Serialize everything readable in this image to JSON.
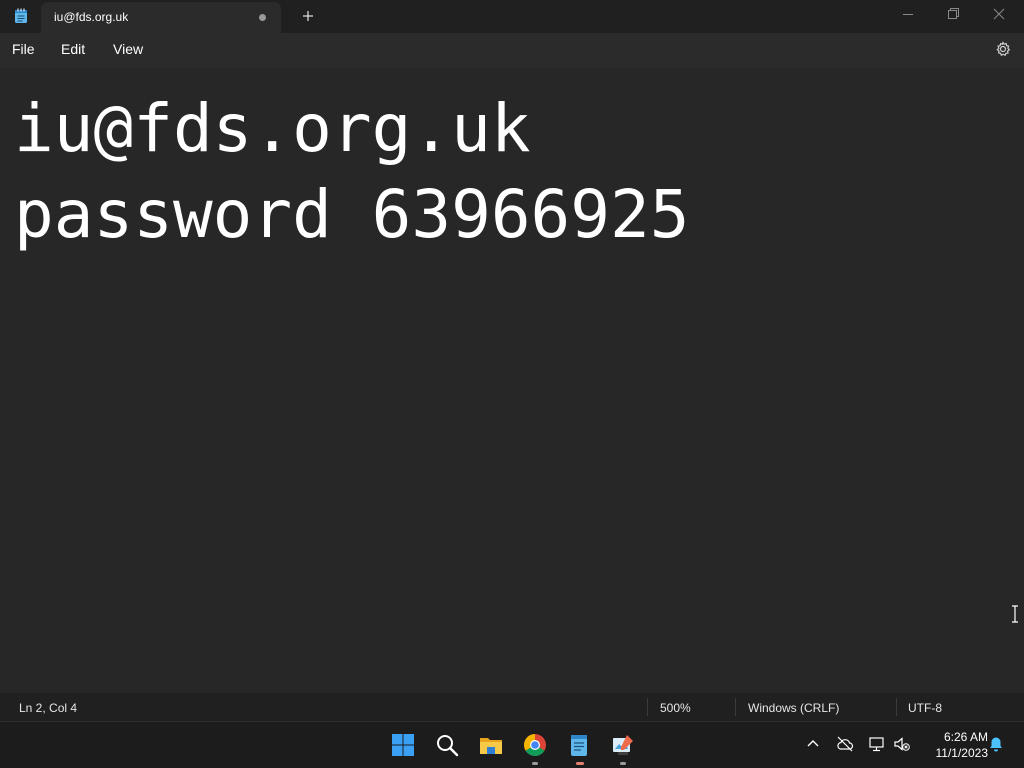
{
  "window": {
    "tab_title": "iu@fds.org.uk",
    "icons": {
      "app": "notepad-icon",
      "new_tab": "plus-icon",
      "minimize": "minimize-icon",
      "maximize": "restore-icon",
      "close": "close-icon"
    }
  },
  "menu": {
    "file": "File",
    "edit": "Edit",
    "view": "View",
    "settings_icon": "gear-icon"
  },
  "editor": {
    "lines": [
      "iu@fds.org.uk",
      "password 63966925"
    ]
  },
  "status": {
    "position": "Ln 2, Col 4",
    "zoom": "500%",
    "line_ending": "Windows (CRLF)",
    "encoding": "UTF-8"
  },
  "taskbar": {
    "apps": [
      "start-icon",
      "search-icon",
      "file-explorer-icon",
      "chrome-icon",
      "notepad-icon",
      "paint-icon"
    ],
    "tray": [
      "chevron-up-icon",
      "cloud-offline-icon",
      "network-icon",
      "volume-muted-icon",
      "notification-bell-icon"
    ],
    "time": "6:26 AM",
    "date": "11/1/2023"
  },
  "colors": {
    "background": "#202020",
    "editor": "#272727",
    "accent": "#4cc2ff"
  }
}
